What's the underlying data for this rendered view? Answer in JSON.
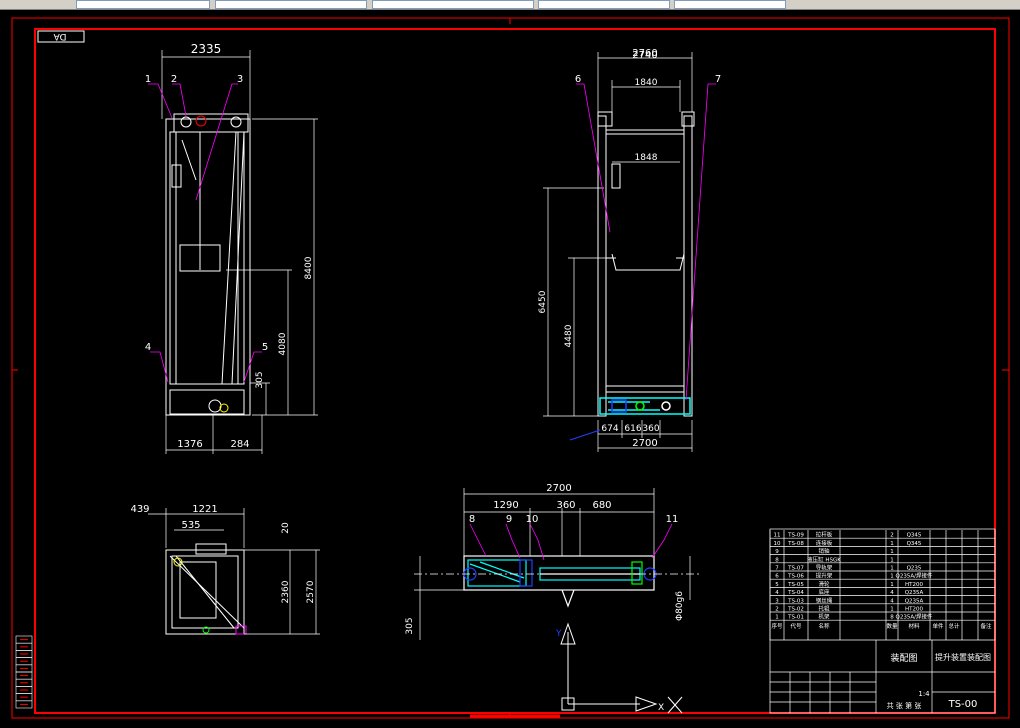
{
  "sheet_tag": "DA",
  "colors": {
    "frame": "#ff0000",
    "geometry": "#ffffff",
    "dims": "#ffffff",
    "leader": "#ff00ff",
    "hatch": "#00ffff",
    "green": "#00ff00",
    "blue": "#2040ff",
    "yellow": "#ffff00"
  },
  "front_view": {
    "parts": [
      "1",
      "2",
      "3",
      "4",
      "5"
    ],
    "dims": {
      "top_width": "2335",
      "height": "8400",
      "mid_height": "4080",
      "small_height": "305",
      "bottom_left": "1376",
      "bottom_right": "284"
    }
  },
  "side_view": {
    "parts": [
      "6",
      "7"
    ],
    "dims": {
      "top_a": "2760",
      "top_b": "2740",
      "top_c": "1840",
      "mid_c": "1848",
      "height": "6450",
      "mid_height": "4480",
      "bottom_a": "674",
      "bottom_b": "616",
      "bottom_c": "360",
      "bottom_total": "2700"
    }
  },
  "plan_view": {
    "dims": {
      "top_a": "439",
      "top_b": "1221",
      "top_c": "535",
      "right_a": "20",
      "height_a": "2360",
      "height_b": "2570"
    }
  },
  "section_view": {
    "parts": [
      "8",
      "9",
      "10",
      "11"
    ],
    "dims": {
      "total": "2700",
      "d1": "1290",
      "d2": "360",
      "d3": "680",
      "left": "305",
      "dia": "Φ80g6"
    }
  },
  "title_block": {
    "rows": [
      {
        "no": "11",
        "code": "TS-09",
        "name": "拉杆板",
        "qty": "2",
        "mat": "Q345"
      },
      {
        "no": "10",
        "code": "TS-08",
        "name": "连接板",
        "qty": "1",
        "mat": "Q345"
      },
      {
        "no": "9",
        "code": "",
        "name": "销轴",
        "qty": "1",
        "mat": ""
      },
      {
        "no": "8",
        "code": "",
        "name": "液压缸 HSGK",
        "qty": "1",
        "mat": ""
      },
      {
        "no": "7",
        "code": "TS-07",
        "name": "导轨架",
        "qty": "1",
        "mat": "Q235"
      },
      {
        "no": "6",
        "code": "TS-06",
        "name": "提升架",
        "qty": "1",
        "mat": "Q235A/焊接件"
      },
      {
        "no": "5",
        "code": "TS-05",
        "name": "滑轮",
        "qty": "1",
        "mat": "HT200"
      },
      {
        "no": "4",
        "code": "TS-04",
        "name": "底座",
        "qty": "4",
        "mat": "Q235A"
      },
      {
        "no": "3",
        "code": "TS-03",
        "name": "钢丝绳",
        "qty": "4",
        "mat": "Q235A"
      },
      {
        "no": "2",
        "code": "TS-02",
        "name": "托辊",
        "qty": "1",
        "mat": "HT200"
      },
      {
        "no": "1",
        "code": "TS-01",
        "name": "机架",
        "qty": "8",
        "mat": "Q235A/焊接件"
      }
    ],
    "header": [
      "序号",
      "代号",
      "名称",
      "数量",
      "材料",
      "单件",
      "总计",
      "备注"
    ],
    "drawing_title": "装配图",
    "drawing_name": "提升装置装配图",
    "drawing_no": "TS-00",
    "scale": "1:4",
    "sheet_label": "共 张 第 张"
  },
  "ucs": {
    "y_label": "Y",
    "x_label": "X"
  },
  "left_legend_rows": 10
}
